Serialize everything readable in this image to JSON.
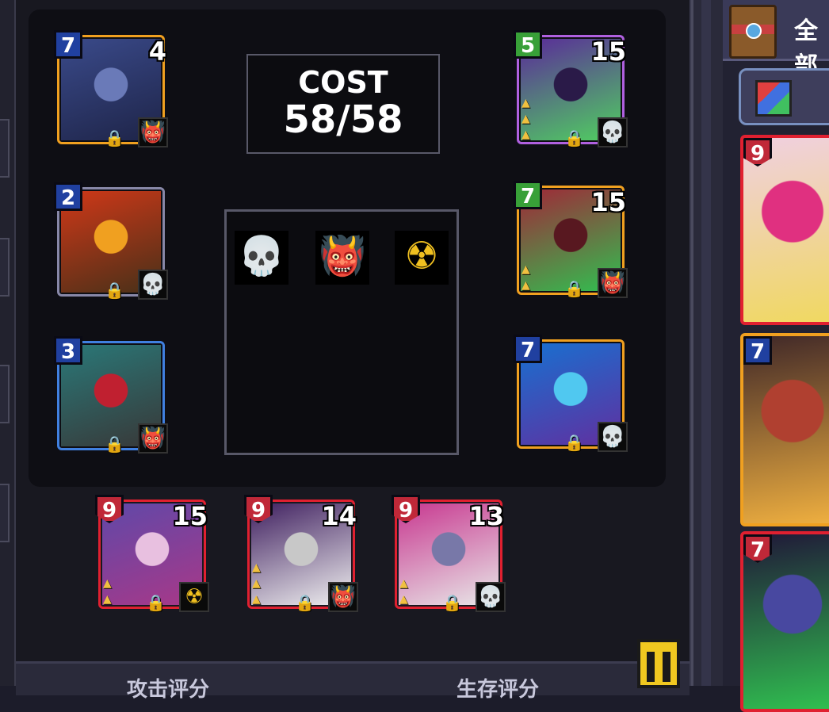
{
  "cost_panel": {
    "title": "COST",
    "value": "58/58"
  },
  "synergies": [
    {
      "icon": "skull-icon",
      "glyph": "💀",
      "color": "#ffffff"
    },
    {
      "icon": "demon-icon",
      "glyph": "👹",
      "color": "#e02020"
    },
    {
      "icon": "radiation-icon",
      "glyph": "☢",
      "color": "#f0c020"
    }
  ],
  "board_cards": [
    {
      "cost": "7",
      "power": "4",
      "type": "demon",
      "frame": "#f0a020",
      "badge": "blue",
      "art": [
        "#3a4a8a",
        "#6a7ab8",
        "#1e2448"
      ]
    },
    {
      "cost": "2",
      "power": "",
      "type": "skull",
      "frame": "#8888a8",
      "badge": "blue",
      "art": [
        "#d03818",
        "#f0a020",
        "#483018"
      ]
    },
    {
      "cost": "3",
      "power": "",
      "type": "demon",
      "frame": "#4080e0",
      "badge": "blue",
      "art": [
        "#2a7878",
        "#c02030",
        "#383838"
      ]
    },
    {
      "cost": "5",
      "power": "15",
      "type": "skull",
      "frame": "#b060e0",
      "badge": "green",
      "art": [
        "#5a2a9a",
        "#2a1a48",
        "#50d060"
      ]
    },
    {
      "cost": "7",
      "power": "15",
      "type": "demon",
      "frame": "#f0a020",
      "badge": "green",
      "art": [
        "#a02838",
        "#581820",
        "#30c050"
      ]
    },
    {
      "cost": "7",
      "power": "",
      "type": "skull",
      "frame": "#f0a020",
      "badge": "blue",
      "art": [
        "#1870d0",
        "#50c8f0",
        "#6030a0"
      ]
    }
  ],
  "bench_cards": [
    {
      "cost": "9",
      "power": "15",
      "type": "radiation",
      "frame": "#e02030",
      "badge": "redpin",
      "art": [
        "#6048a8",
        "#e8c0e0",
        "#a83888"
      ]
    },
    {
      "cost": "9",
      "power": "14",
      "type": "demon",
      "frame": "#e02030",
      "badge": "redpin",
      "art": [
        "#402060",
        "#c8c8c8",
        "#f0f0f0"
      ]
    },
    {
      "cost": "9",
      "power": "13",
      "type": "skull",
      "frame": "#e02030",
      "badge": "redpin",
      "art": [
        "#c83890",
        "#7878a8",
        "#e8e8e8"
      ]
    }
  ],
  "right_panel": {
    "tab_label": "全部",
    "cards": [
      {
        "cost": "9",
        "frame": "#e02030",
        "art": [
          "#f0d0e0",
          "#e03080",
          "#f0d860"
        ]
      },
      {
        "cost": "7",
        "frame": "#f0a020",
        "art": [
          "#402828",
          "#b04030",
          "#f0b040"
        ]
      },
      {
        "cost": "7",
        "frame": "#e02030",
        "art": [
          "#201838",
          "#4848a0",
          "#30c050"
        ]
      }
    ]
  },
  "bottom_bar": {
    "left_label": "攻击评分",
    "right_label": "生存评分"
  }
}
